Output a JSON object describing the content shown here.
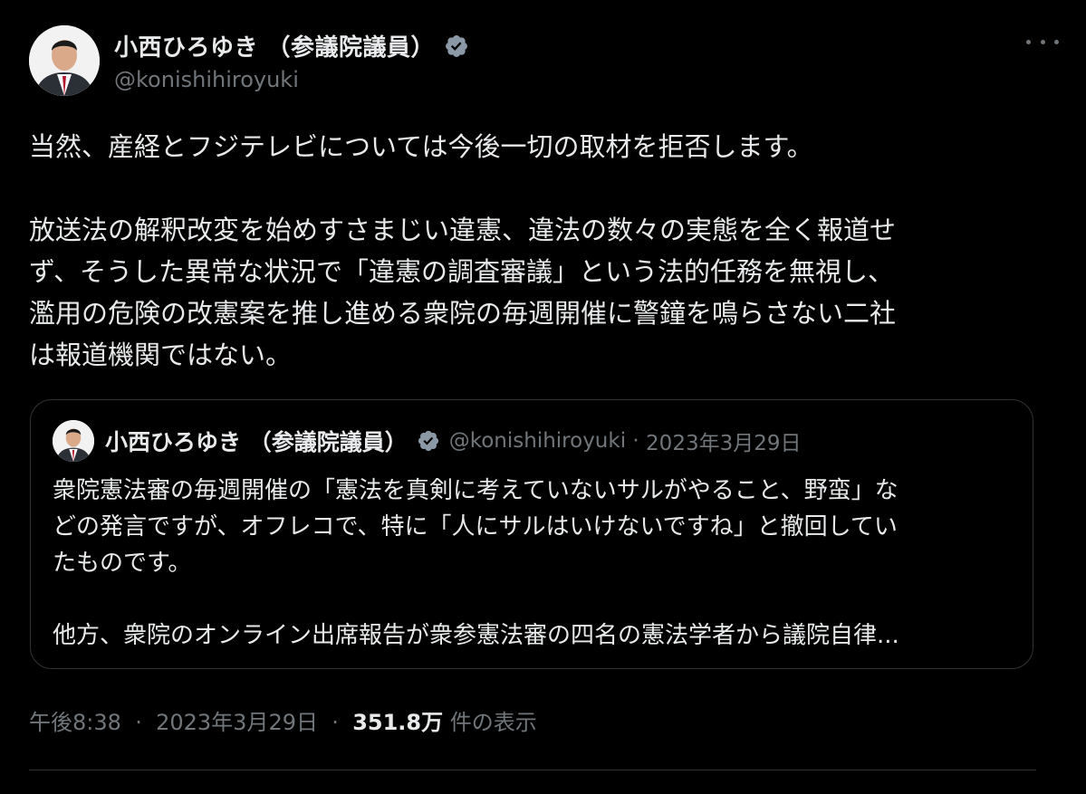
{
  "author": {
    "display_name": "小西ひろゆき （参議院議員）",
    "handle": "@konishihiroyuki"
  },
  "tweet": {
    "paragraph1": "当然、産経とフジテレビについては今後一切の取材を拒否します。",
    "paragraph2_lines": [
      "放送法の解釈改変を始めすさまじい違憲、違法の数々の実態を全く報道せ",
      "ず、そうした異常な状況で「違憲の調査審議」という法的任務を無視し、",
      "濫用の危険の改憲案を推し進める衆院の毎週開催に警鐘を鳴らさない二社",
      "は報道機関ではない。"
    ],
    "time": "午後8:38",
    "date": "2023年3月29日",
    "views_count": "351.8万",
    "views_label": "件の表示",
    "separator": "·"
  },
  "quoted_tweet": {
    "display_name": "小西ひろゆき （参議院議員）",
    "handle": "@konishihiroyuki",
    "separator": "·",
    "date": "2023年3月29日",
    "lines": [
      "衆院憲法審の毎週開催の「憲法を真剣に考えていないサルがやること、野蛮」な",
      "どの発言ですが、オフレコで、特に「人にサルはいけないですね」と撤回してい",
      "たものです。"
    ],
    "line_after_gap": "他方、衆院のオンライン出席報告が衆参憲法審の四名の憲法学者から議院自律..."
  },
  "icons": {
    "verified": "verified-badge-icon",
    "more": "more-options-icon"
  },
  "colors": {
    "background": "#000000",
    "text_primary": "#e7e9ea",
    "text_secondary": "#71767b",
    "border": "#2f3336",
    "verified_badge": "#8b98a5"
  }
}
